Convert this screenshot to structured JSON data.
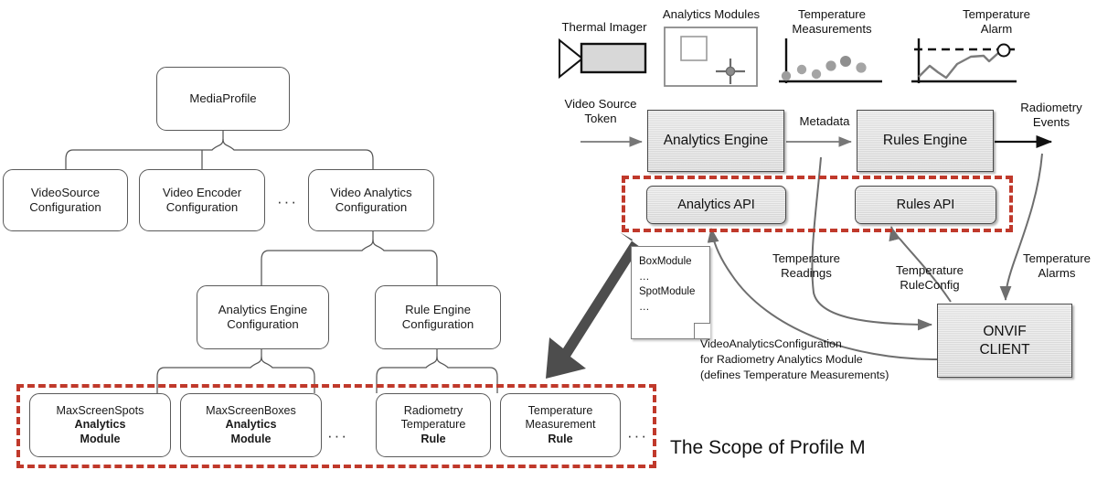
{
  "title": "ONVIF Profile M Scope",
  "colors": {
    "scope_red": "#c0392b",
    "box_grey": "#d8d8d8",
    "arrow_grey": "#6e6e6e",
    "big_arrow": "#4d4d4d"
  },
  "tree": {
    "root": {
      "label": "MediaProfile"
    },
    "level2": [
      {
        "label_line1": "VideoSource",
        "label_line2": "Configuration"
      },
      {
        "label_line1": "Video Encoder",
        "label_line2": "Configuration"
      },
      {
        "label_line1": "Video Analytics",
        "label_line2": "Configuration"
      }
    ],
    "level2_ellipsis": "···",
    "level3": [
      {
        "label_line1": "Analytics Engine",
        "label_line2": "Configuration"
      },
      {
        "label_line1": "Rule Engine",
        "label_line2": "Configuration"
      }
    ],
    "level4": [
      {
        "line1": "MaxScreenSpots",
        "line2": "Analytics",
        "line3": "Module"
      },
      {
        "line1": "MaxScreenBoxes",
        "line2": "Analytics",
        "line3": "Module"
      },
      {
        "line1": "Radiometry",
        "line2": "Temperature",
        "line3": "Rule"
      },
      {
        "line1": "Temperature",
        "line2": "Measurement",
        "line3": "Rule"
      }
    ],
    "level4_ellipsis_a": "···",
    "level4_ellipsis_b": "···"
  },
  "icons": {
    "thermal_imager": {
      "label": "Thermal Imager"
    },
    "analytics_modules": {
      "label": "Analytics Modules"
    },
    "temperature_measurements": {
      "label_line1": "Temperature",
      "label_line2": "Measurements"
    },
    "temperature_alarm": {
      "label_line1": "Temperature",
      "label_line2": "Alarm"
    }
  },
  "flow": {
    "video_source_token": {
      "line1": "Video Source",
      "line2": "Token"
    },
    "analytics_engine": {
      "label": "Analytics Engine"
    },
    "metadata": {
      "label": "Metadata"
    },
    "rules_engine": {
      "label": "Rules Engine"
    },
    "radiometry_events": {
      "line1": "Radiometry",
      "line2": "Events"
    },
    "analytics_api": {
      "label": "Analytics API"
    },
    "rules_api": {
      "label": "Rules API"
    },
    "temperature_readings": {
      "line1": "Temperature",
      "line2": "Readings"
    },
    "temperature_ruleconfig": {
      "line1": "Temperature",
      "line2": "RuleConfig"
    },
    "temperature_alarms": {
      "line1": "Temperature",
      "line2": "Alarms"
    },
    "onvif_client": {
      "line1": "ONVIF",
      "line2": "CLIENT"
    }
  },
  "note": {
    "line1": "BoxModule",
    "line2": "…",
    "line3": "SpotModule",
    "line4": "…"
  },
  "note_caption": {
    "line1": "VideoAnalyticsConfiguration",
    "line2": "for Radiometry Analytics Module",
    "line3": "(defines Temperature Measurements)"
  },
  "scope_caption": {
    "label": "The Scope of Profile M"
  }
}
